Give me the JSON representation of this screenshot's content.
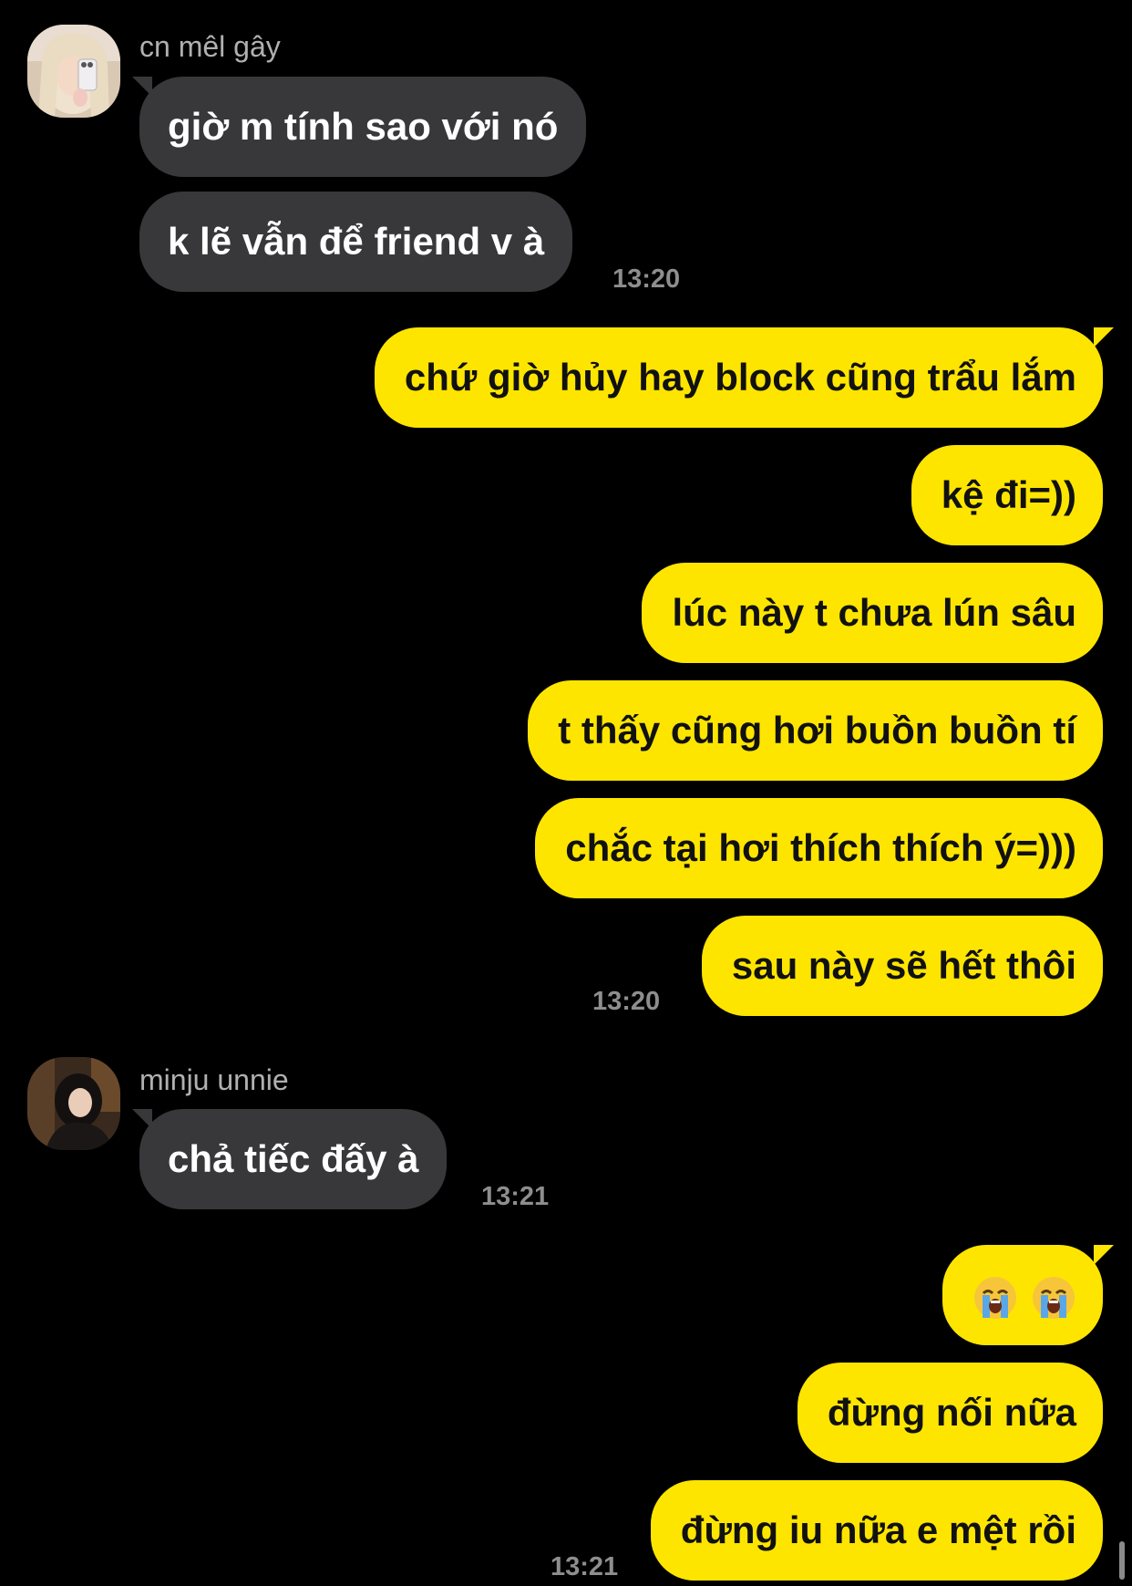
{
  "colors": {
    "background": "#000000",
    "incoming_bubble": "#38383a",
    "outgoing_bubble": "#fee500",
    "timestamp": "#8e8e8e",
    "sender_name": "#b0b0b0"
  },
  "groups": [
    {
      "direction": "incoming",
      "sender": "cn mêl gây",
      "avatar": "avatar-blonde-selfie",
      "messages": [
        "giờ m tính sao với nó",
        "k lẽ vẫn để friend v à"
      ],
      "time": "13:20"
    },
    {
      "direction": "outgoing",
      "messages": [
        "chứ giờ hủy hay block cũng trẩu lắm",
        "kệ đi=))",
        "lúc này t chưa lún sâu",
        "t thấy cũng hơi buồn buồn tí",
        "chắc tại hơi thích thích ý=)))",
        "sau này sẽ hết thôi"
      ],
      "time": "13:20"
    },
    {
      "direction": "incoming",
      "sender": "minju unnie",
      "avatar": "avatar-dark-hair",
      "messages": [
        "chả tiếc đấy à"
      ],
      "time": "13:21"
    },
    {
      "direction": "outgoing",
      "messages": [
        "😭😭",
        "đừng nối nữa",
        "đừng iu nữa e mệt rồi"
      ],
      "emoji_icons": [
        "loudly-crying-face-icon",
        "loudly-crying-face-icon"
      ],
      "time": "13:21"
    }
  ]
}
